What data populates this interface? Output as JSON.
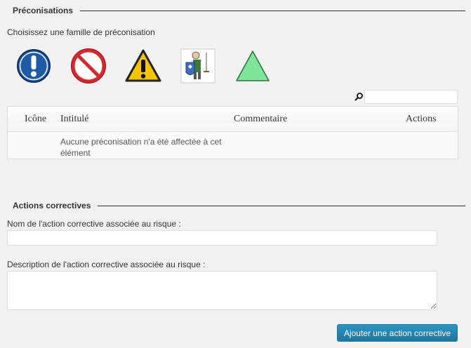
{
  "preconisations": {
    "legend": "Préconisations",
    "family_prompt": "Choisissez une famille de préconisation",
    "families": [
      {
        "icon": "mandatory-action-icon",
        "color": "#1f5aa6"
      },
      {
        "icon": "prohibition-icon",
        "color": "#d7282f"
      },
      {
        "icon": "warning-icon",
        "color": "#f5c400"
      },
      {
        "icon": "knight-protection-icon",
        "color": "#4a8a3c"
      },
      {
        "icon": "green-triangle-icon",
        "color": "#7fe59a"
      }
    ],
    "search": {
      "value": ""
    },
    "table": {
      "columns": [
        "Icône",
        "Intitulé",
        "Commentaire",
        "Actions"
      ],
      "empty_message": "Aucune préconisation n'a été affectée à cet élément"
    }
  },
  "actions_correctives": {
    "legend": "Actions correctives",
    "name_label": "Nom de l'action corrective associée au risque :",
    "name_value": "",
    "description_label": "Description de l'action corrective associée au risque :",
    "description_value": "",
    "submit_label": "Ajouter une action corrective"
  },
  "colors": {
    "primary_button": "#21759b",
    "background": "#f1f1f1"
  }
}
